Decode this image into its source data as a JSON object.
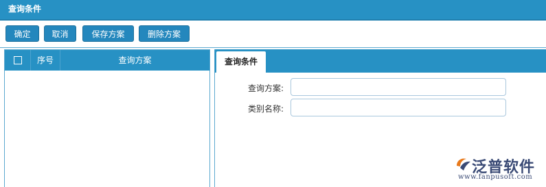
{
  "window": {
    "title": "查询条件"
  },
  "toolbar": {
    "confirm_label": "确定",
    "cancel_label": "取消",
    "save_label": "保存方案",
    "delete_label": "删除方案"
  },
  "grid": {
    "columns": [
      "序号",
      "查询方案"
    ],
    "rows": []
  },
  "panel": {
    "tab_label": "查询条件",
    "fields": [
      {
        "label": "查询方案:",
        "value": ""
      },
      {
        "label": "类别名称:",
        "value": ""
      }
    ]
  },
  "logo": {
    "text": "泛普软件",
    "url": "www.fanpusoft.com"
  },
  "colors": {
    "header_blue": "#2791c4",
    "button_blue": "#2487bd",
    "logo_navy": "#3a4a75",
    "logo_orange": "#e8791b"
  }
}
